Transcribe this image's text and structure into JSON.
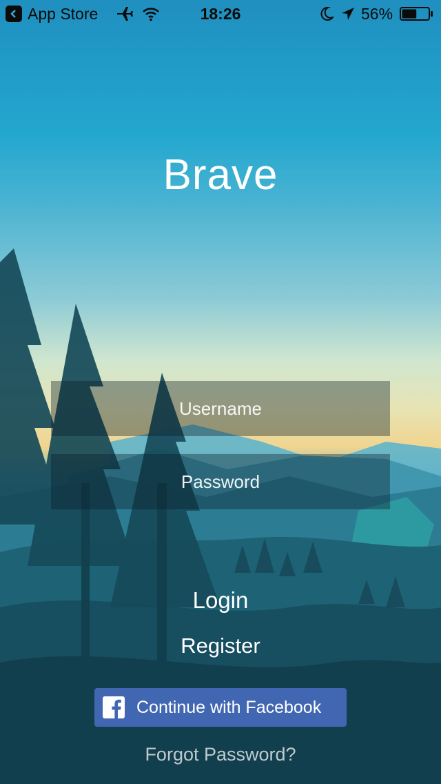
{
  "status_bar": {
    "back_label": "App Store",
    "time": "18:26",
    "battery_percent": "56%",
    "battery_level": 0.56,
    "icons": [
      "back-chevron-icon",
      "airplane-icon",
      "wifi-icon",
      "moon-icon",
      "location-arrow-icon",
      "battery-icon"
    ]
  },
  "app": {
    "title": "Brave"
  },
  "login_form": {
    "username_placeholder": "Username",
    "password_placeholder": "Password",
    "login_label": "Login",
    "register_label": "Register"
  },
  "facebook": {
    "label": "Continue with Facebook",
    "color": "#4267b2",
    "icon": "facebook-logo-icon"
  },
  "forgot_password": {
    "label": "Forgot Password?"
  }
}
